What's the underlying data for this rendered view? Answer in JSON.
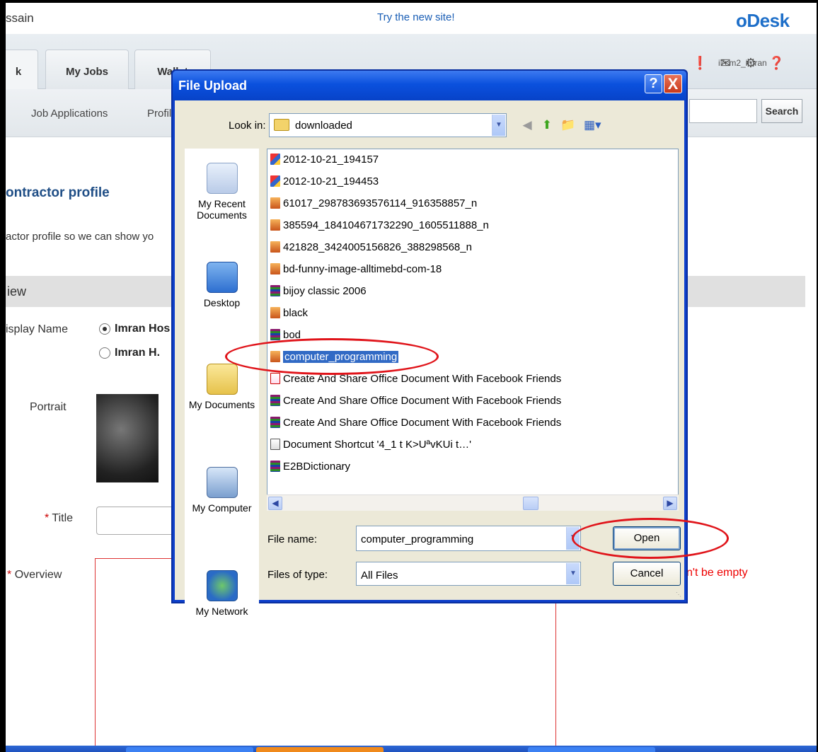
{
  "page": {
    "user_name": "ssain",
    "try_link": "Try the new site!",
    "brand": "oDesk",
    "account": "i7cm2_imran",
    "tabs": [
      {
        "label": "k"
      },
      {
        "label": "My Jobs"
      },
      {
        "label": "Wallet"
      }
    ],
    "top_icons": [
      "alert-icon",
      "mail-icon",
      "gear-icon",
      "help-icon"
    ],
    "subnav": [
      "Job Applications",
      "Profile"
    ],
    "search_button": "Search",
    "heading": "ontractor profile",
    "subheading": "actor profile so we can show yo",
    "section": "iew",
    "display_name_label": "isplay Name",
    "display_options": [
      "Imran Hos",
      "Imran H."
    ],
    "portrait_label": "Portrait",
    "title_label": "Title",
    "overview_label": "Overview",
    "required_mark": "*",
    "error_text": "n't be empty"
  },
  "dialog": {
    "title": "File Upload",
    "help_label": "?",
    "close_label": "X",
    "look_in_label": "Look in:",
    "look_in_value": "downloaded",
    "places": [
      {
        "label": "My Recent Documents",
        "icon": "recent-docs-icon"
      },
      {
        "label": "Desktop",
        "icon": "desktop-icon"
      },
      {
        "label": "My Documents",
        "icon": "my-documents-icon"
      },
      {
        "label": "My Computer",
        "icon": "my-computer-icon"
      },
      {
        "label": "My Network",
        "icon": "my-network-icon"
      }
    ],
    "files": [
      {
        "name": "2012-10-21_194157",
        "type": "image"
      },
      {
        "name": "2012-10-21_194453",
        "type": "image"
      },
      {
        "name": "61017_298783693576114_916358857_n",
        "type": "jpeg"
      },
      {
        "name": "385594_184104671732290_1605511888_n",
        "type": "jpeg"
      },
      {
        "name": "421828_3424005156826_388298568_n",
        "type": "jpeg"
      },
      {
        "name": "bd-funny-image-alltimebd-com-18",
        "type": "jpeg"
      },
      {
        "name": "bijoy classic 2006",
        "type": "archive"
      },
      {
        "name": "black",
        "type": "jpeg"
      },
      {
        "name": "bod",
        "type": "archive"
      },
      {
        "name": "computer_programming",
        "type": "jpeg"
      },
      {
        "name": "Create And Share Office Document With Facebook Friends",
        "type": "pdf"
      },
      {
        "name": "Create And Share Office Document With Facebook Friends",
        "type": "archive"
      },
      {
        "name": "Create And Share Office Document With Facebook Friends",
        "type": "archive"
      },
      {
        "name": "Document Shortcut '4_1 t K>UªvKUi t…'",
        "type": "shortcut"
      },
      {
        "name": "E2BDictionary",
        "type": "archive"
      }
    ],
    "selected_file": "computer_programming",
    "file_name_label": "File name:",
    "file_name_value": "computer_programming",
    "files_of_type_label": "Files of type:",
    "files_of_type_value": "All Files",
    "open_button": "Open",
    "cancel_button": "Cancel"
  },
  "colors": {
    "annotation_ring": "#e0141a",
    "xp_title": "#0b51de",
    "selection": "#316ac5",
    "link": "#1a5eb5",
    "error": "#e00000"
  }
}
